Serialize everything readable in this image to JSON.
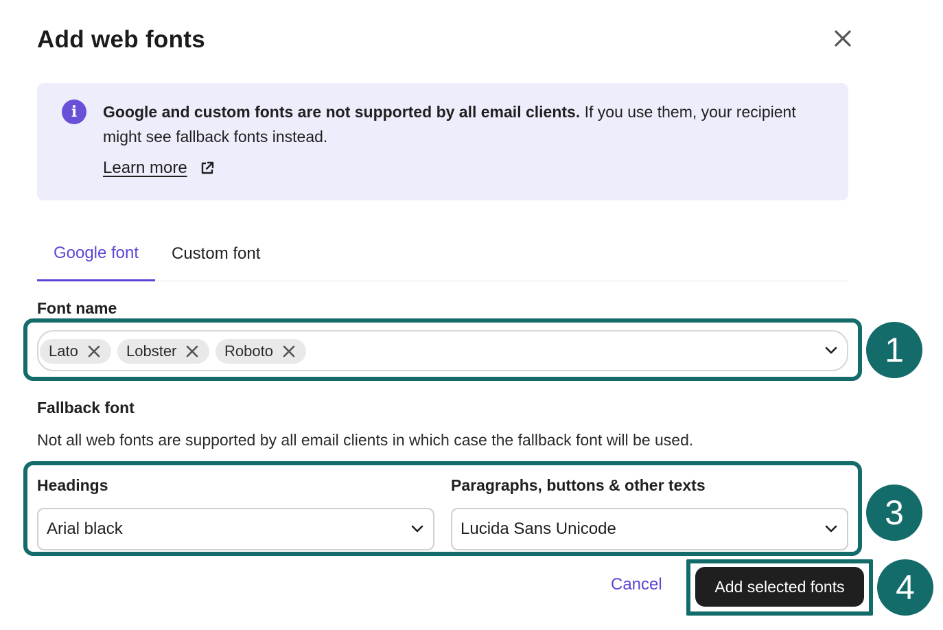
{
  "dialog": {
    "title": "Add web fonts",
    "close_icon": "close-icon"
  },
  "info": {
    "icon": "info-icon",
    "icon_glyph": "i",
    "bold_text": "Google and custom fonts are not supported by all email clients.",
    "text": " If you use them, your recipient might see fallback fonts instead.",
    "learn_more": "Learn more",
    "learn_more_icon": "external-link-icon"
  },
  "tabs": [
    {
      "label": "Google font",
      "active": true
    },
    {
      "label": "Custom font",
      "active": false
    }
  ],
  "font_name": {
    "label": "Font name",
    "chips": [
      "Lato",
      "Lobster",
      "Roboto"
    ],
    "remove_icon": "close-icon",
    "dropdown_icon": "chevron-down-icon"
  },
  "fallback": {
    "label": "Fallback font",
    "description": "Not all web fonts are supported by all email clients in which case the fallback font will be used.",
    "headings_label": "Headings",
    "headings_value": "Arial black",
    "paragraphs_label": "Paragraphs, buttons & other texts",
    "paragraphs_value": "Lucida Sans Unicode"
  },
  "actions": {
    "cancel": "Cancel",
    "add": "Add selected fonts"
  },
  "annotations": [
    "1",
    "3",
    "4"
  ],
  "colors": {
    "accent": "#5b46d6",
    "info_bg": "#eeedfb",
    "annotation": "#136b6a",
    "primary_button": "#1f1f1f"
  }
}
